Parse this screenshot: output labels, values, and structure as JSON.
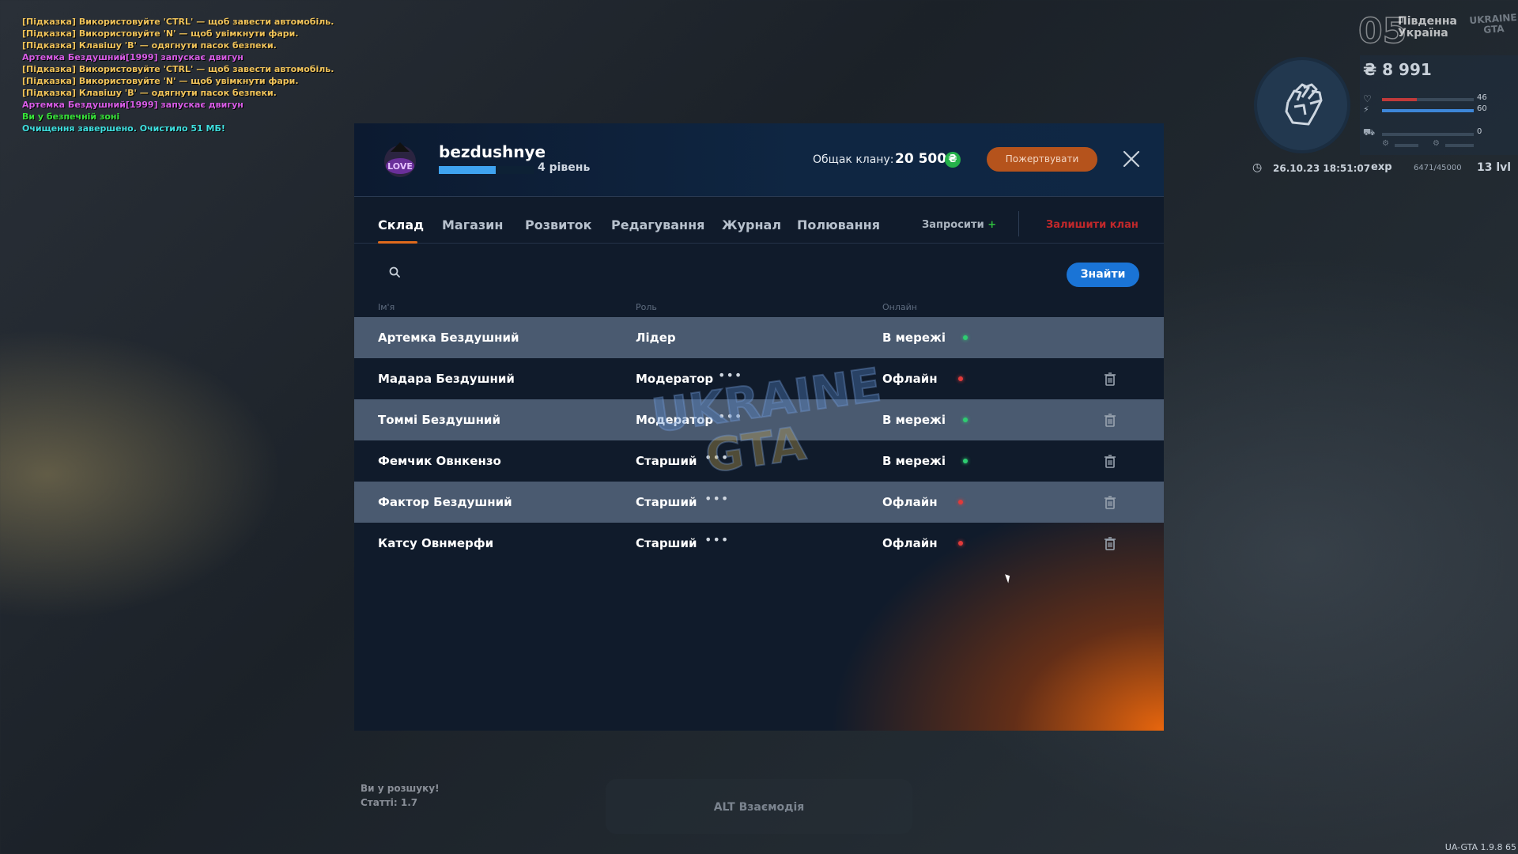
{
  "chat": [
    {
      "text": "[Підказка] Використовуйте 'CTRL' — щоб завести автомобіль.",
      "color": "#f0c35a"
    },
    {
      "text": "[Підказка] Використовуйте 'N' — щоб увімкнути фари.",
      "color": "#f0c35a"
    },
    {
      "text": "[Підказка] Клавішу 'B' — одягнути пасок безпеки.",
      "color": "#f0c35a"
    },
    {
      "text": " Артемка Бездушний[1999] запускає двигун",
      "color": "#d75ce6"
    },
    {
      "text": "[Підказка] Використовуйте 'CTRL' — щоб завести автомобіль.",
      "color": "#f0c35a"
    },
    {
      "text": "[Підказка] Використовуйте 'N' — щоб увімкнути фари.",
      "color": "#f0c35a"
    },
    {
      "text": "[Підказка] Клавішу 'B' — одягнути пасок безпеки.",
      "color": "#f0c35a"
    },
    {
      "text": " Артемка Бездушний[1999] запускає двигун",
      "color": "#d75ce6"
    },
    {
      "text": "Ви у безпечній зоні",
      "color": "#38e33a"
    },
    {
      "text": "Очищення завершено. Очистило 51 МБ!",
      "color": "#3fe0e0"
    }
  ],
  "hud": {
    "zone_number": "05",
    "zone_name": "Південна Україна",
    "logo_text": "UKRAINE GTA",
    "money": "₴ 8 991",
    "health": "46",
    "armor": "60",
    "vehicle": "0",
    "datetime": "26.10.23 18:51:07",
    "exp_label": "exp",
    "exp_value": "6471/45000",
    "level": "13 lvl"
  },
  "clan": {
    "name": "bezdushnye",
    "level_text": "4 рівень",
    "xp_progress": 0.6,
    "treasury_label": "Общак клану:",
    "treasury_value": "20 500",
    "currency_symbol": "₴",
    "donate_label": "Пожертвувати",
    "tabs": [
      "Склад",
      "Магазин",
      "Розвиток",
      "Редагування",
      "Журнал",
      "Полювання"
    ],
    "active_tab": "Склад",
    "invite_label": "Запросити",
    "leave_label": "Залишити клан",
    "search_placeholder": "",
    "find_label": "Знайти",
    "columns": {
      "name": "Ім'я",
      "role": "Роль",
      "online": "Онлайн"
    },
    "members": [
      {
        "name": "Артемка Бездушний",
        "role": "Лідер",
        "status": "В мережі",
        "online": true,
        "menu": false,
        "delete": false
      },
      {
        "name": "Мадара Бездушний",
        "role": "Модератор",
        "status": "Офлайн",
        "online": false,
        "menu": true,
        "delete": true
      },
      {
        "name": "Томмі Бездушний",
        "role": "Модератор",
        "status": "В мережі",
        "online": true,
        "menu": true,
        "delete": true
      },
      {
        "name": "Фемчик Овнкензо",
        "role": "Старший",
        "status": "В мережі",
        "online": true,
        "menu": true,
        "delete": true
      },
      {
        "name": "Фактор Бездушний",
        "role": "Старший",
        "status": "Офлайн",
        "online": false,
        "menu": true,
        "delete": true
      },
      {
        "name": "Катсу Овнмерфи",
        "role": "Старший",
        "status": "Офлайн",
        "online": false,
        "menu": true,
        "delete": true
      }
    ],
    "online_color": "#2ecc71",
    "offline_color": "#e03a3a",
    "accent_orange": "#e06a1c",
    "accent_blue": "#1a74d6"
  },
  "wanted": {
    "line1": "Ви у розшуку!",
    "line2": "Статті: 1.7"
  },
  "interaction_hint": "ALT Взаємодія",
  "version": "UA-GTA 1.9.8 65"
}
